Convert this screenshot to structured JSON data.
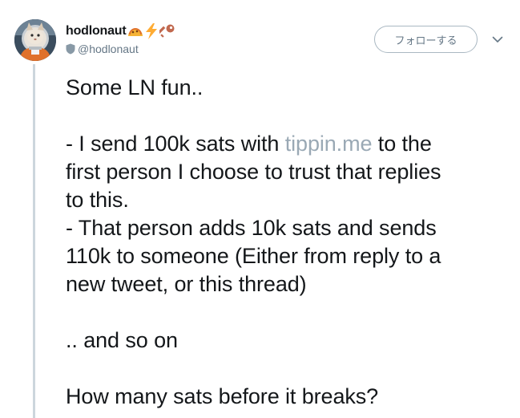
{
  "author": {
    "display_name": "hodlonaut",
    "handle": "@hodlonaut",
    "name_emojis": [
      "taco-emoji",
      "lightning-emoji",
      "key-emoji"
    ],
    "avatar": "astronaut-cat-avatar"
  },
  "follow_button": {
    "label": "フォローする"
  },
  "tweet": {
    "line1": "Some LN fun..",
    "line2_pre": "- I send 100k sats with ",
    "line2_link": "tippin.me",
    "line2_post": " to the",
    "line3": "first person I choose to trust that replies",
    "line4": "to this.",
    "line5": "- That person adds 10k sats and sends",
    "line6": "110k to someone (Either from reply to a",
    "line7": "new tweet, or this thread)",
    "line8": ".. and so on",
    "line9": "How many sats before it breaks?"
  },
  "colors": {
    "link": "#9aa9b5",
    "secondary_text": "#657786",
    "thread_line": "#ccd6dd"
  }
}
